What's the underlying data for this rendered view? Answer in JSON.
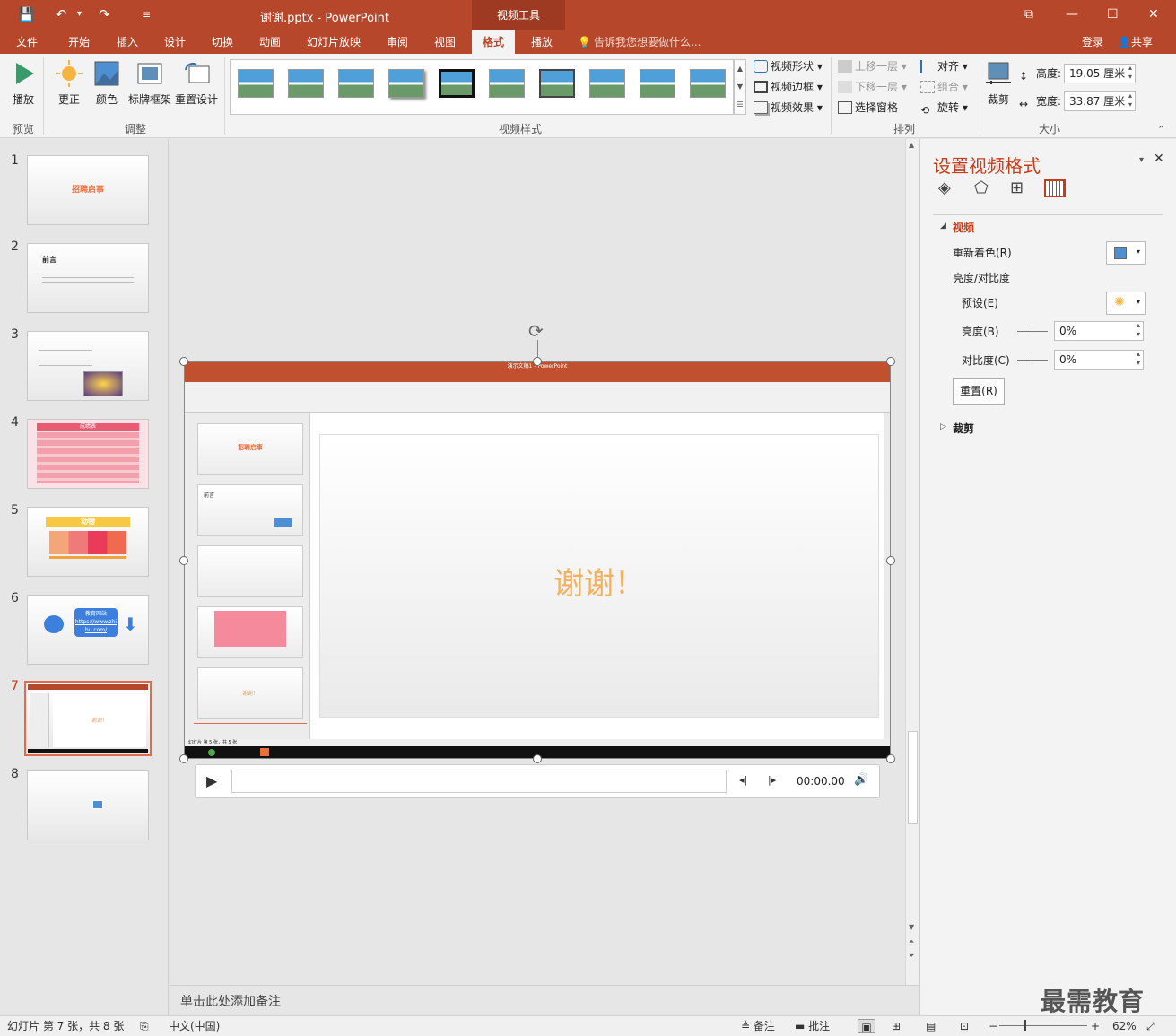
{
  "window": {
    "title": "谢谢.pptx - PowerPoint",
    "context_tool": "视频工具"
  },
  "quick_access": {
    "save": "💾",
    "undo": "↶",
    "undo_drop": "▾",
    "redo": "↷",
    "customize": "≡"
  },
  "window_controls": {
    "ribbon_display": "⧉",
    "minimize": "—",
    "maximize": "☐",
    "close": "✕"
  },
  "tabs": [
    "文件",
    "开始",
    "插入",
    "设计",
    "切换",
    "动画",
    "幻灯片放映",
    "审阅",
    "视图",
    "格式",
    "播放"
  ],
  "active_tab": "格式",
  "tell_me": "告诉我您想要做什么...",
  "login": "登录",
  "share": "共享",
  "ribbon": {
    "preview": {
      "play": "播放",
      "group": "预览"
    },
    "adjust": {
      "correct": "更正",
      "color": "颜色",
      "poster": "标牌框架",
      "reset": "重置设计",
      "group": "调整"
    },
    "styles": {
      "group": "视频样式",
      "shape": "视频形状",
      "border": "视频边框",
      "effect": "视频效果"
    },
    "arrange": {
      "group": "排列",
      "forward": "上移一层",
      "backward": "下移一层",
      "selection": "选择窗格",
      "align": "对齐",
      "group_btn": "组合",
      "rotate": "旋转"
    },
    "size": {
      "group": "大小",
      "crop": "裁剪",
      "height_label": "高度:",
      "height": "19.05 厘米",
      "width_label": "宽度:",
      "width": "33.87 厘米"
    }
  },
  "slides": [
    {
      "num": "1",
      "title": "招聘启事"
    },
    {
      "num": "2",
      "title": "前言"
    },
    {
      "num": "3",
      "title": ""
    },
    {
      "num": "4",
      "title": "成绩表"
    },
    {
      "num": "5",
      "title": "动物"
    },
    {
      "num": "6",
      "title": "教育网站"
    },
    {
      "num": "7",
      "title": ""
    },
    {
      "num": "8",
      "title": ""
    }
  ],
  "slide6_link": "https://www.zhihu.com/",
  "video": {
    "slide_text": "谢谢！",
    "time": "00:00.00"
  },
  "inner_video": {
    "title": "演示文稿1 - PowerPoint",
    "status": "幻灯片 第 5 张，共 5 张"
  },
  "notes_placeholder": "单击此处添加备注",
  "pane": {
    "title": "设置视频格式",
    "section_video": "视频",
    "recolor": "重新着色(R)",
    "brightness_contrast": "亮度/对比度",
    "preset": "预设(E)",
    "brightness": "亮度(B)",
    "brightness_value": "0%",
    "contrast": "对比度(C)",
    "contrast_value": "0%",
    "reset": "重置(R)",
    "section_crop": "裁剪"
  },
  "status": {
    "slide_info": "幻灯片 第 7 张，共 8 张",
    "language": "中文(中国)",
    "notes": "备注",
    "comments": "批注",
    "zoom": "62%"
  },
  "watermark": "最需教育",
  "colors": {
    "accent": "#b7472a",
    "context": "#9e3a22"
  }
}
